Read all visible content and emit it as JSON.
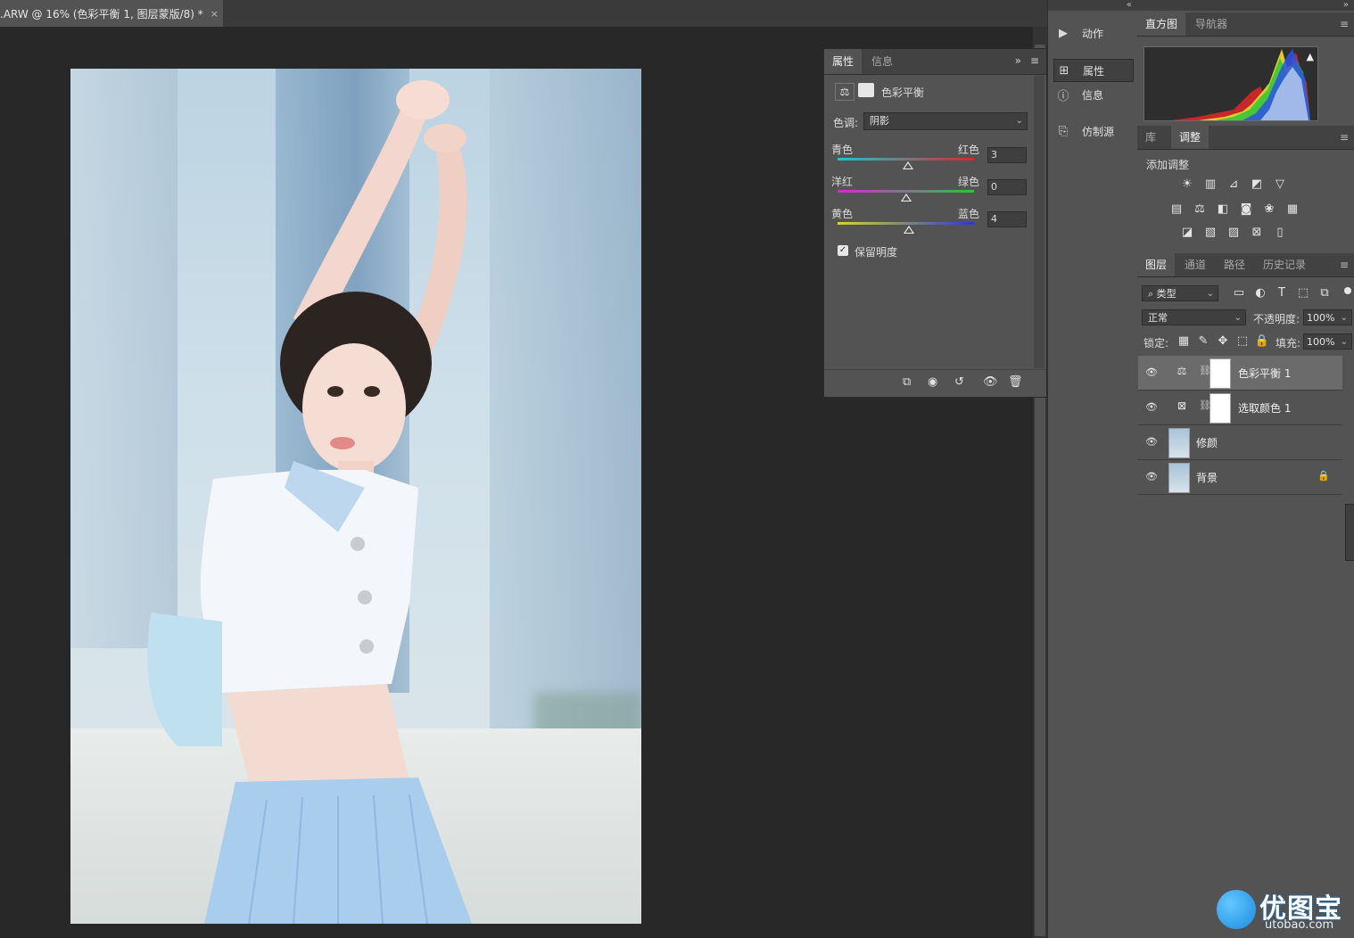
{
  "document": {
    "tab_title": ".ARW @ 16% (色彩平衡 1, 图层蒙版/8) *",
    "close_glyph": "×"
  },
  "mid_panel": {
    "items": [
      {
        "label": "动作",
        "icon": "play-icon"
      },
      {
        "label": "属性",
        "icon": "properties-icon"
      },
      {
        "label": "信息",
        "icon": "info-icon"
      },
      {
        "label": "仿制源",
        "icon": "clone-source-icon"
      }
    ]
  },
  "histogram_panel": {
    "tabs": [
      "直方图",
      "导航器"
    ],
    "warning_glyph": "▲"
  },
  "adjustments_panel": {
    "tabs": [
      "库",
      "调整"
    ],
    "add_label": "添加调整"
  },
  "layers_panel": {
    "tabs": [
      "图层",
      "通道",
      "路径",
      "历史记录"
    ],
    "filter_label": "类型",
    "blend_mode": "正常",
    "opacity_label": "不透明度:",
    "opacity_value": "100%",
    "lock_label": "锁定:",
    "fill_label": "填充:",
    "fill_value": "100%",
    "layers": [
      {
        "name": "色彩平衡 1",
        "type": "adjustment",
        "selected": true
      },
      {
        "name": "选取颜色 1",
        "type": "adjustment",
        "selected": false
      },
      {
        "name": "修颜",
        "type": "pixel",
        "selected": false
      },
      {
        "name": "背景",
        "type": "background",
        "selected": false
      }
    ]
  },
  "properties_panel": {
    "tabs": [
      "属性",
      "信息"
    ],
    "title": "色彩平衡",
    "tone_label": "色调:",
    "tone_value": "阴影",
    "sliders": [
      {
        "left": "青色",
        "right": "红色",
        "value": "3",
        "fraction": 0.515
      },
      {
        "left": "洋红",
        "right": "绿色",
        "value": "0",
        "fraction": 0.5
      },
      {
        "left": "黄色",
        "right": "蓝色",
        "value": "4",
        "fraction": 0.52
      }
    ],
    "preserve_luminosity": "保留明度",
    "preserve_checked": true
  },
  "watermark": {
    "brand": "优图宝",
    "url": "utobao.com"
  },
  "colors": {
    "panel_bg": "#535353",
    "dark_bg": "#282828",
    "accent_blue": "#1a8be0"
  }
}
